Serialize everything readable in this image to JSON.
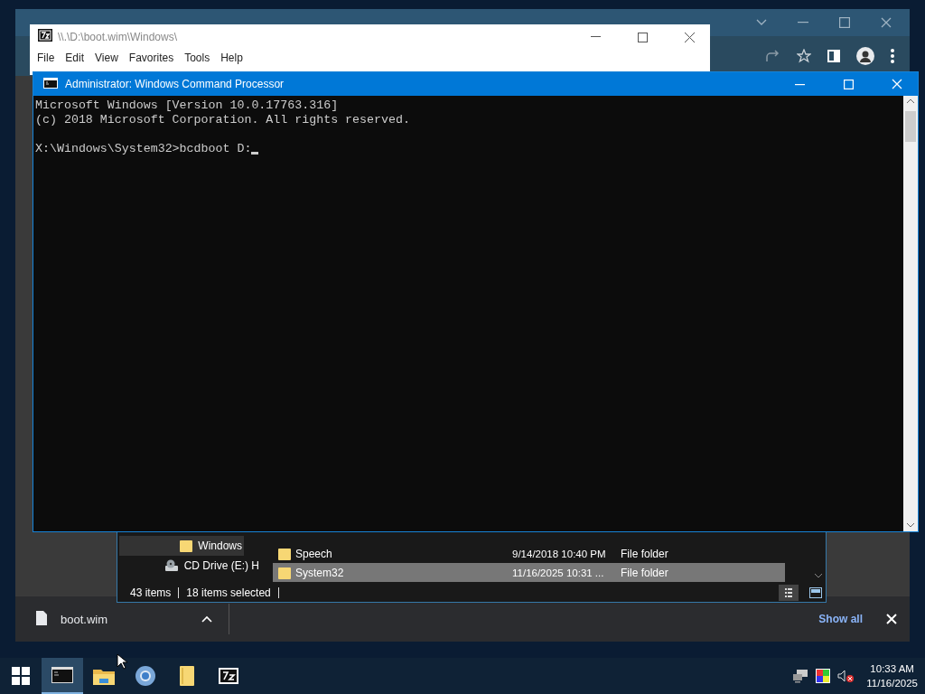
{
  "archive_window": {
    "title": "\\\\.\\D:\\boot.wim\\Windows\\",
    "menu": [
      "File",
      "Edit",
      "View",
      "Favorites",
      "Tools",
      "Help"
    ]
  },
  "console": {
    "title": "Administrator: Windows Command Processor",
    "output": [
      "Microsoft Windows [Version 10.0.17763.316]",
      "(c) 2018 Microsoft Corporation. All rights reserved."
    ],
    "prompt": "X:\\Windows\\System32>bcdboot D:",
    "cursor_visible": true
  },
  "explorer": {
    "nav": [
      {
        "label": "Windows",
        "kind": "folder",
        "selected": true
      },
      {
        "label": "CD Drive (E:) H",
        "kind": "drive",
        "selected": false
      }
    ],
    "files": [
      {
        "name": "Speech",
        "date": "9/14/2018 10:40 PM",
        "type": "File folder",
        "selected": false
      },
      {
        "name": "System32",
        "date": "11/16/2025 10:31 ...",
        "type": "File folder",
        "selected": true
      }
    ],
    "status": {
      "count": "43 items",
      "selection": "18 items selected"
    }
  },
  "download_bar": {
    "file": "boot.wim",
    "show_all": "Show all"
  },
  "taskbar": {
    "apps": [
      {
        "kind": "console",
        "active": true
      },
      {
        "kind": "explorer",
        "active": false
      },
      {
        "kind": "browser",
        "active": false
      },
      {
        "kind": "folder",
        "active": false
      },
      {
        "kind": "archiver",
        "active": false
      }
    ],
    "clock": {
      "time": "10:33 AM",
      "date": "11/16/2025"
    }
  }
}
